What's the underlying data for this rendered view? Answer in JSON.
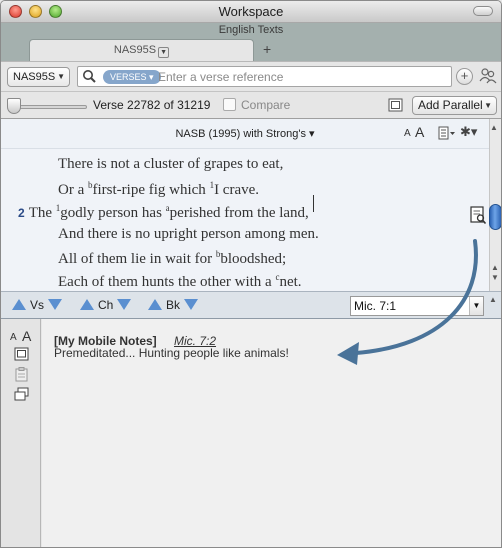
{
  "window": {
    "title": "Workspace"
  },
  "tabs": {
    "group_title": "English Texts",
    "active_tab": "NAS95S",
    "add_tab_icon": "+"
  },
  "search": {
    "resource": "NAS95S",
    "filter_pill": "VERSES",
    "placeholder": "Enter a verse reference"
  },
  "verse_bar": {
    "position_text": "Verse 22782 of 31219",
    "slider_value": 0,
    "compare_label": "Compare",
    "add_parallel_label": "Add Parallel"
  },
  "text_pane": {
    "translation": "NASB (1995) with Strong's",
    "font_small": "A",
    "font_large": "A"
  },
  "verses": [
    {
      "text": "There is not a cluster of grapes to eat,"
    },
    {
      "text_a": "Or a ",
      "sup1": "b",
      "text_b": "first-ripe fig which ",
      "sup2": "1",
      "text_c": "I crave."
    },
    {
      "num": "2",
      "text_a": "The ",
      "sup1": "1",
      "text_b": "godly person has ",
      "sup2": "a",
      "text_c": "perished from the land,"
    },
    {
      "text": "And there is no upright person among men."
    },
    {
      "text_a": "All of them lie in wait for ",
      "sup1": "b",
      "text_b": "bloodshed;"
    },
    {
      "text_a": "Each of them hunts the other with a ",
      "sup1": "c",
      "text_b": "net."
    }
  ],
  "nav": {
    "verse_label": "Vs",
    "chapter_label": "Ch",
    "book_label": "Bk",
    "reference": "Mic. 7:1"
  },
  "notes": {
    "font_small": "A",
    "font_large": "A",
    "title": "[My Mobile Notes]",
    "reference": "Mic. 7:2",
    "body": "Premeditated... Hunting people like animals!"
  },
  "colors": {
    "accent_blue": "#5a8fd0",
    "annotation_arrow": "#4a7399",
    "pill": "#86a6cb",
    "verse_number": "#2a4a87"
  },
  "icons": {
    "search": "magnifier-icon",
    "add_circle": "plus-circle-icon",
    "people": "people-icon",
    "sync": "sync-icon",
    "note": "note-marker-icon"
  }
}
